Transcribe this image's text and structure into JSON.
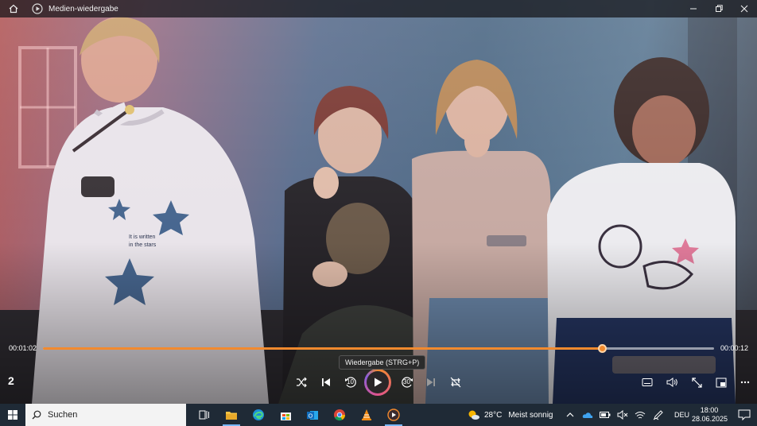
{
  "window": {
    "title": "Medien-wiedergabe",
    "buttons": [
      "minimize",
      "restore",
      "close"
    ]
  },
  "player": {
    "current_time": "00:01:02",
    "duration": "00:00:12",
    "progress_fraction": 0.833,
    "track_number": "2",
    "tooltip": "Wiedergabe (STRG+P)",
    "accent": "#f28a2e",
    "skip_back_seconds": "10",
    "skip_forward_seconds": "30",
    "video_text": {
      "hoodie_print": "It is written in the stars"
    }
  },
  "taskbar": {
    "search_placeholder": "Suchen",
    "apps": [
      "task-view",
      "file-explorer",
      "edge",
      "microsoft-store",
      "outlook",
      "chrome",
      "vlc",
      "media-player"
    ],
    "weather": {
      "temperature": "28°C",
      "condition": "Meist sonnig"
    },
    "language": "DEU",
    "time": "18:00",
    "date": "28.06.2025"
  }
}
